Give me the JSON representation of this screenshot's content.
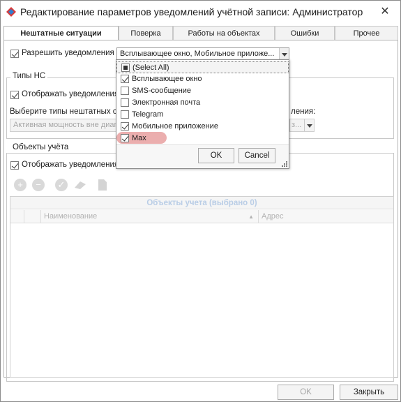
{
  "window": {
    "title": "Редактирование параметров уведомлений учётной записи: Администратор",
    "close_glyph": "✕",
    "icon": "diamond-app-icon"
  },
  "tabs": [
    {
      "label": "Нештатные ситуации",
      "active": true
    },
    {
      "label": "Поверка",
      "active": false
    },
    {
      "label": "Работы на объектах",
      "active": false
    },
    {
      "label": "Ошибки",
      "active": false
    },
    {
      "label": "Прочее",
      "active": false
    }
  ],
  "notifications": {
    "allow_label": "Разрешить уведомления",
    "allow_checked": true,
    "channels_value": "Всплывающее окно, Мобильное приложе..."
  },
  "ns_types": {
    "group_title": "Типы НС",
    "show_label": "Отображать уведомления",
    "show_checked": true,
    "select_label": "Выберите типы нештатных си",
    "select_value": "Активная мощность вне диап",
    "right_label": "ления:",
    "right_value": "з..."
  },
  "objects": {
    "group_title": "Объекты учёта",
    "show_label": "Отображать уведомления",
    "show_checked": true,
    "grid_title": "Объекты учета (выбрано 0)",
    "columns": [
      "Наименование",
      "Адрес"
    ],
    "toolbar_icons": [
      "add-icon",
      "remove-icon",
      "check-icon",
      "eraser-icon",
      "document-icon"
    ]
  },
  "dropdown": {
    "items": [
      {
        "label": "(Select All)",
        "state": "indeterminate"
      },
      {
        "label": "Всплывающее окно",
        "state": "checked"
      },
      {
        "label": "SMS-сообщение",
        "state": "unchecked"
      },
      {
        "label": "Электронная почта",
        "state": "unchecked"
      },
      {
        "label": "Telegram",
        "state": "unchecked"
      },
      {
        "label": "Мобильное приложение",
        "state": "checked"
      },
      {
        "label": "Max",
        "state": "checked"
      }
    ],
    "ok_label": "OK",
    "cancel_label": "Cancel",
    "highlight_color": "#e8a0a0"
  },
  "footer": {
    "ok_label": "OK",
    "close_label": "Закрыть"
  }
}
